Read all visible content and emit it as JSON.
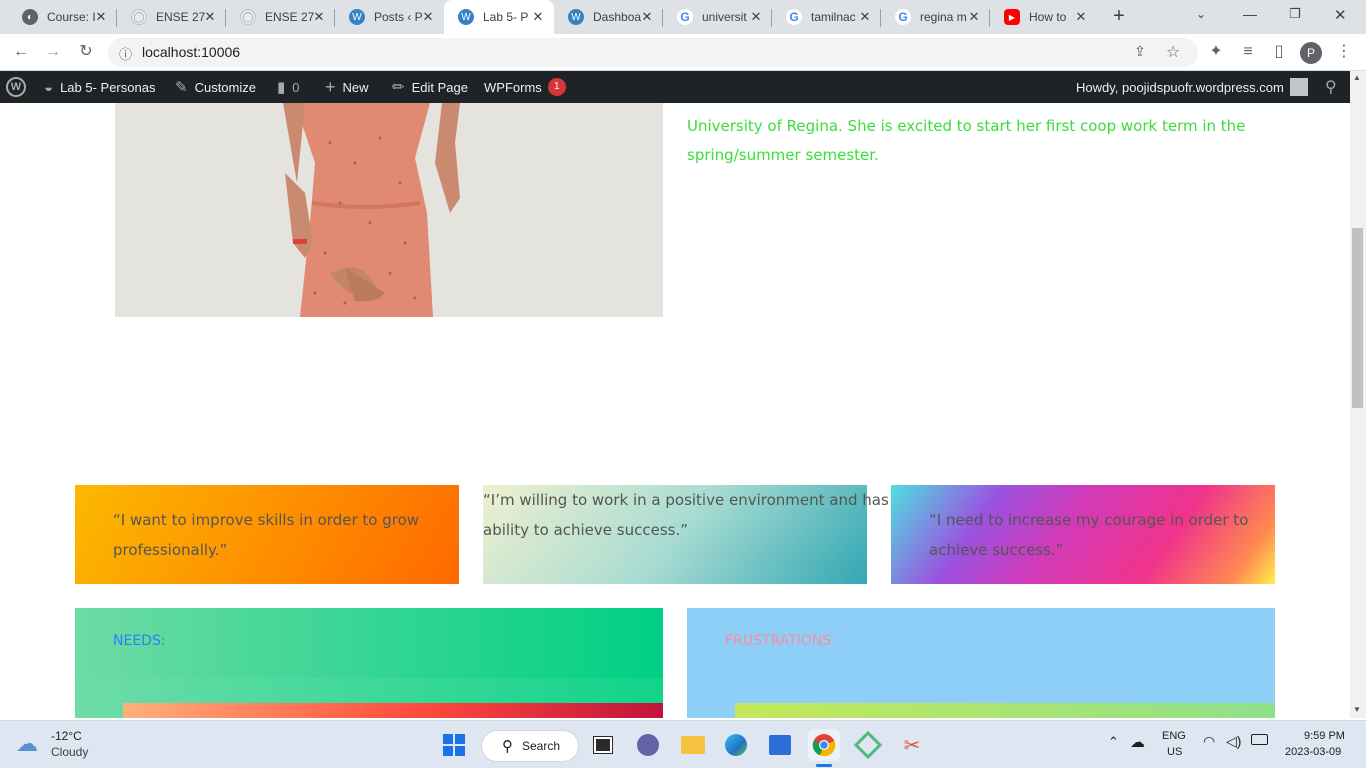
{
  "browser": {
    "tabs": [
      {
        "title": "Course: I",
        "favicon": "course-icon",
        "color": "#5f6368"
      },
      {
        "title": "ENSE 27",
        "favicon": "globe-icon",
        "color": "#9aa0a6"
      },
      {
        "title": "ENSE 27",
        "favicon": "globe-icon",
        "color": "#9aa0a6"
      },
      {
        "title": "Posts ‹ P",
        "favicon": "wordpress-icon",
        "color": "#3582c4"
      },
      {
        "title": "Lab 5- P",
        "favicon": "wordpress-icon",
        "color": "#3582c4"
      },
      {
        "title": "Dashboa",
        "favicon": "wordpress-icon",
        "color": "#3582c4"
      },
      {
        "title": "universit",
        "favicon": "google-icon",
        "color": "#4285f4"
      },
      {
        "title": "tamilnac",
        "favicon": "google-icon",
        "color": "#4285f4"
      },
      {
        "title": "regina m",
        "favicon": "google-icon",
        "color": "#4285f4"
      },
      {
        "title": "How to",
        "favicon": "youtube-icon",
        "color": "#ff0000"
      }
    ],
    "new_tab": "+",
    "url": "localhost:10006",
    "profile_initial": "P"
  },
  "adminbar": {
    "site_name": "Lab 5- Personas",
    "customize": "Customize",
    "comments_count": "0",
    "new": "New",
    "edit_page": "Edit Page",
    "wpforms": "WPForms",
    "wpforms_badge": "1",
    "howdy": "Howdy, poojidspuofr.wordpress.com"
  },
  "bio": {
    "line1": "University of Regina. She is excited to start her first coop work term in the",
    "line2": "spring/summer semester."
  },
  "quotes": {
    "q1_line1": "“I want to improve skills in order to grow",
    "q1_line2": "professionally.”",
    "q2_line1": "“I’m willing to work in a positive environment and has the",
    "q2_line2": "ability to achieve success.”",
    "q3_line1": "“I need to increase my courage in order to",
    "q3_line2": "achieve success.”"
  },
  "sections": {
    "needs": "NEEDS:",
    "needs_color": "#2d7ff9",
    "frustrations": "FRUSTRATIONS:",
    "frustrations_color": "#f78da7"
  },
  "taskbar": {
    "temperature": "-12°C",
    "weather": "Cloudy",
    "search": "Search",
    "lang": "ENG",
    "region": "US",
    "time": "9:59 PM",
    "date": "2023-03-09"
  }
}
